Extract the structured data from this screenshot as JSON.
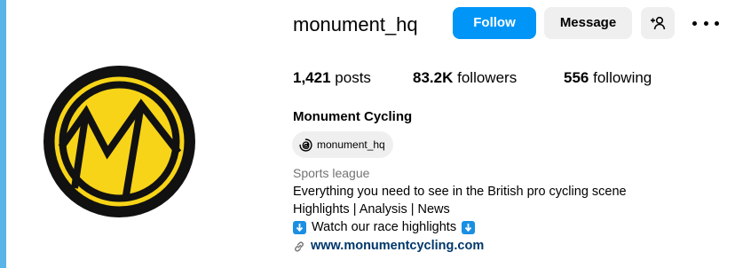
{
  "profile": {
    "username": "monument_hq",
    "display_name": "Monument Cycling",
    "category": "Sports league"
  },
  "actions": {
    "follow_label": "Follow",
    "message_label": "Message"
  },
  "stats": {
    "posts_count": "1,421",
    "posts_label": "posts",
    "followers_count": "83.2K",
    "followers_label": "followers",
    "following_count": "556",
    "following_label": "following"
  },
  "threads": {
    "handle": "monument_hq"
  },
  "bio": {
    "line1": "Everything you need to see in the British pro cycling scene",
    "line2": "Highlights | Analysis | News",
    "line3": "Watch our race highlights"
  },
  "link": {
    "text": "www.monumentcycling.com"
  },
  "colors": {
    "follow_blue": "#0095f6",
    "logo_yellow": "#f7d417",
    "link_color": "#00376b",
    "page_border": "#5ab4e8"
  },
  "icons": {
    "add_user": "add-user-icon",
    "more": "more-options-icon",
    "threads": "threads-icon",
    "link": "link-icon",
    "arrow_down": "arrow-down-emoji-icon"
  }
}
